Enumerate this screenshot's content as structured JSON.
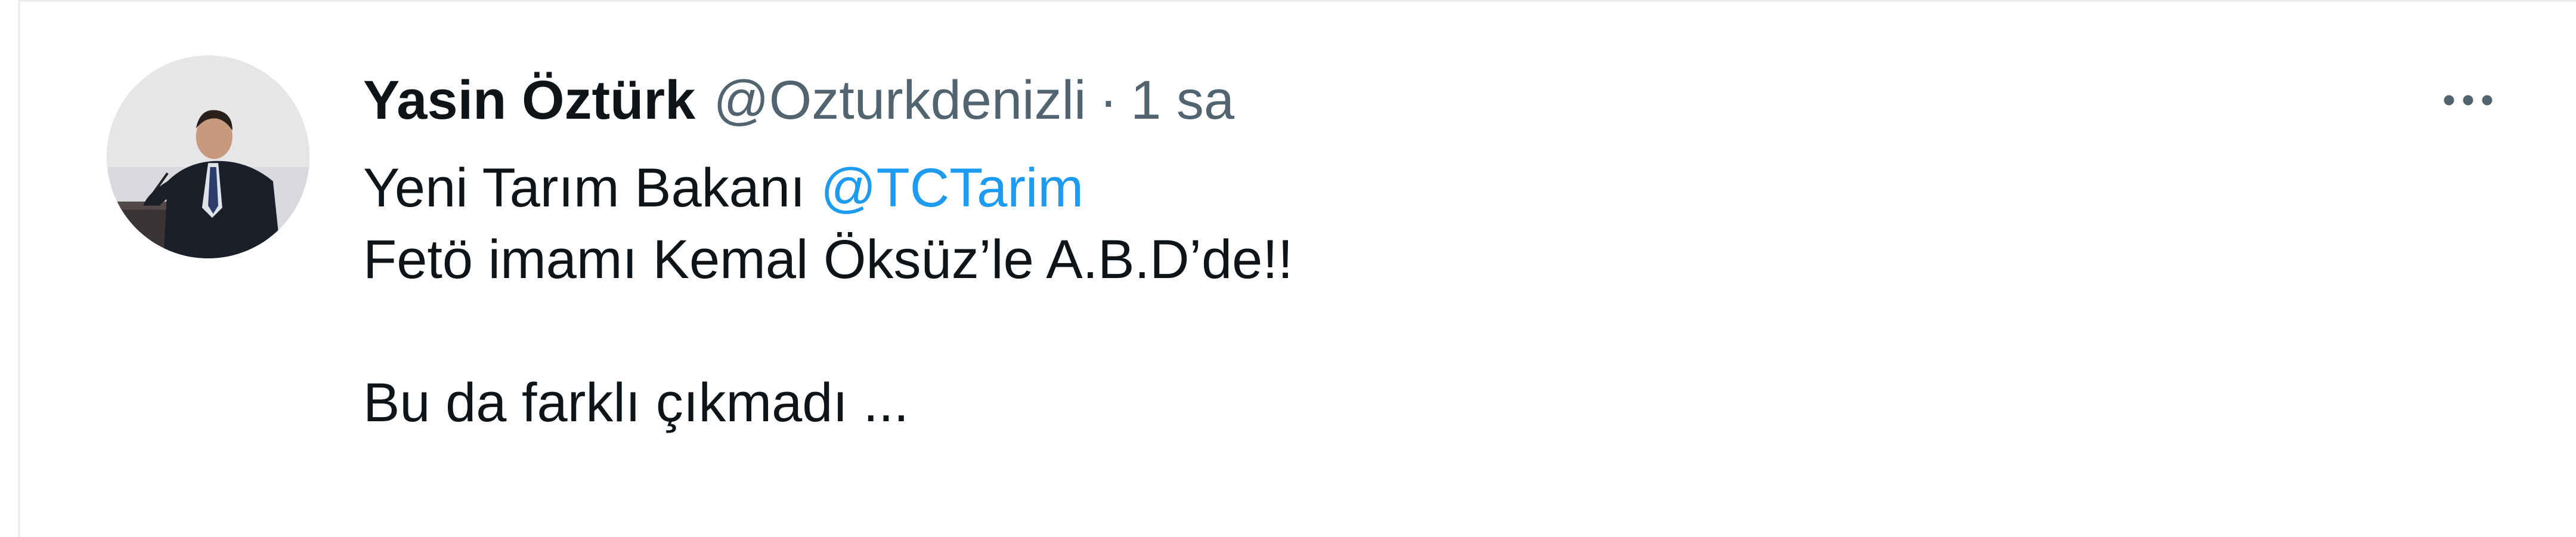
{
  "tweet": {
    "author": {
      "display_name": "Yasin Öztürk",
      "username": "@Ozturkdenizli"
    },
    "separator": "·",
    "timestamp": "1 sa",
    "more_icon": "more-horizontal-icon",
    "text": {
      "line1_prefix": "Yeni Tarım Bakanı ",
      "line1_mention": "@TCTarim",
      "line2": "Fetö imamı Kemal Öksüz’le A.B.D’de!!",
      "line4": "Bu da farklı çıkmadı ..."
    }
  },
  "colors": {
    "text_primary": "#0f1419",
    "text_secondary": "#536471",
    "link": "#1d9bf0",
    "border": "#eceff1"
  }
}
